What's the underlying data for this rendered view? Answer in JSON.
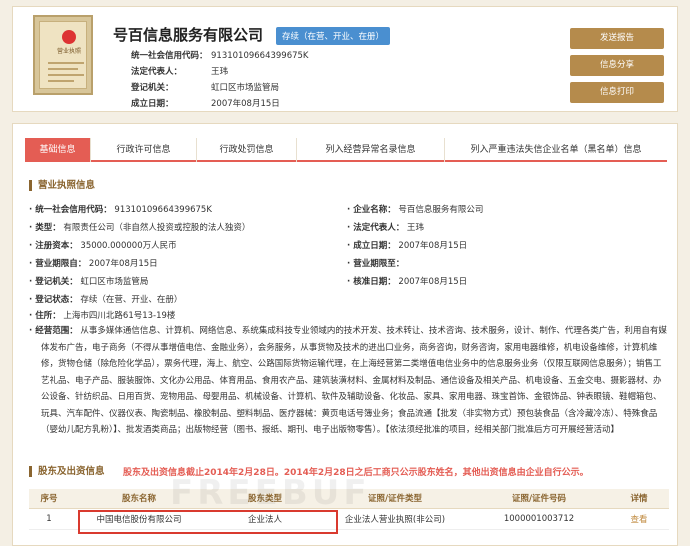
{
  "header": {
    "company_name": "号百信息服务有限公司",
    "status": "存续（在营、开业、在册）",
    "seal": {
      "title": "营业执照",
      "emblem": "national-emblem-icon"
    },
    "rows": [
      {
        "label": "统一社会信用代码：",
        "value": "91310109664399675K"
      },
      {
        "label": "法定代表人：",
        "value": "王玮"
      },
      {
        "label": "登记机关：",
        "value": "虹口区市场监管局"
      },
      {
        "label": "成立日期：",
        "value": "2007年08月15日"
      }
    ],
    "buttons": [
      "发送报告",
      "信息分享",
      "信息打印"
    ]
  },
  "tabs": [
    "基础信息",
    "行政许可信息",
    "行政处罚信息",
    "列入经营异常名录信息",
    "列入严重违法失信企业名单（黑名单）信息"
  ],
  "license": {
    "title": "营业执照信息",
    "left": [
      {
        "label": "· 统一社会信用代码：",
        "value": "91310109664399675K"
      },
      {
        "label": "· 类型：",
        "value": "有限责任公司（非自然人投资或控股的法人独资）"
      },
      {
        "label": "· 注册资本：",
        "value": "35000.000000万人民币"
      },
      {
        "label": "· 营业期限自：",
        "value": "2007年08月15日"
      },
      {
        "label": "· 登记机关：",
        "value": "虹口区市场监管局"
      },
      {
        "label": "· 登记状态：",
        "value": "存续（在营、开业、在册）"
      },
      {
        "label": "· 住所：",
        "value": "上海市四川北路61号13-19楼"
      }
    ],
    "right": [
      {
        "label": "· 企业名称：",
        "value": "号百信息服务有限公司"
      },
      {
        "label": "· 法定代表人：",
        "value": "王玮"
      },
      {
        "label": "· 成立日期：",
        "value": "2007年08月15日"
      },
      {
        "label": "· 营业期限至：",
        "value": ""
      },
      {
        "label": "· 核准日期：",
        "value": "2007年08月15日"
      }
    ],
    "scope_label": "· 经营范围：",
    "scope_text": "从事多媒体通信信息、计算机、网络信息、系统集成科技专业领域内的技术开发、技术转让、技术咨询、技术服务，设计、制作、代理各类广告，利用自有媒体发布广告，电子商务（不得从事增值电信、金融业务），会务服务，从事货物及技术的进出口业务，商务咨询，财务咨询，家用电器维修，机电设备维修，计算机维修，货物仓储（除危险化学品），票务代理，海上、航空、公路国际货物运输代理，在上海经营第二类增值电信业务中的信息服务业务（仅限互联网信息服务）；销售工艺礼品、电子产品、服装服饰、文化办公用品、体育用品、食用农产品、建筑装潢材料、金属材料及制品、通信设备及相关产品、机电设备、五金交电、摄影器材、办公设备、针纺织品、日用百货、宠物用品、母婴用品、机械设备、计算机、软件及辅助设备、化妆品、家具、家用电器、珠宝首饰、金银饰品、钟表眼镜、鞋帽箱包、玩具、汽车配件、仪器仪表、陶瓷制品、橡胶制品、塑料制品、医疗器械：黄页电话号簿业务；食品流通【批发（非实物方式）预包装食品（含冷藏冷冻）、特殊食品（婴幼儿配方乳粉）】、批发酒类商品；出版物经营（图书、报纸、期刊、电子出版物零售）。【依法须经批准的项目，经相关部门批准后方可开展经营活动】"
  },
  "shareholders": {
    "title": "股东及出资信息",
    "notice": "股东及出资信息截止2014年2月28日。2014年2月28日之后工商只公示股东姓名，其他出资信息由企业自行公示。",
    "columns": [
      "序号",
      "股东名称",
      "股东类型",
      "证照/证件类型",
      "证照/证件号码",
      "详情"
    ],
    "rows": [
      {
        "index": "1",
        "name": "中国电信股份有限公司",
        "type": "企业法人",
        "cert_type": "企业法人营业执照(非公司)",
        "cert_no": "1000001003712",
        "detail": "查看"
      }
    ]
  },
  "watermark": "FREEBUF"
}
